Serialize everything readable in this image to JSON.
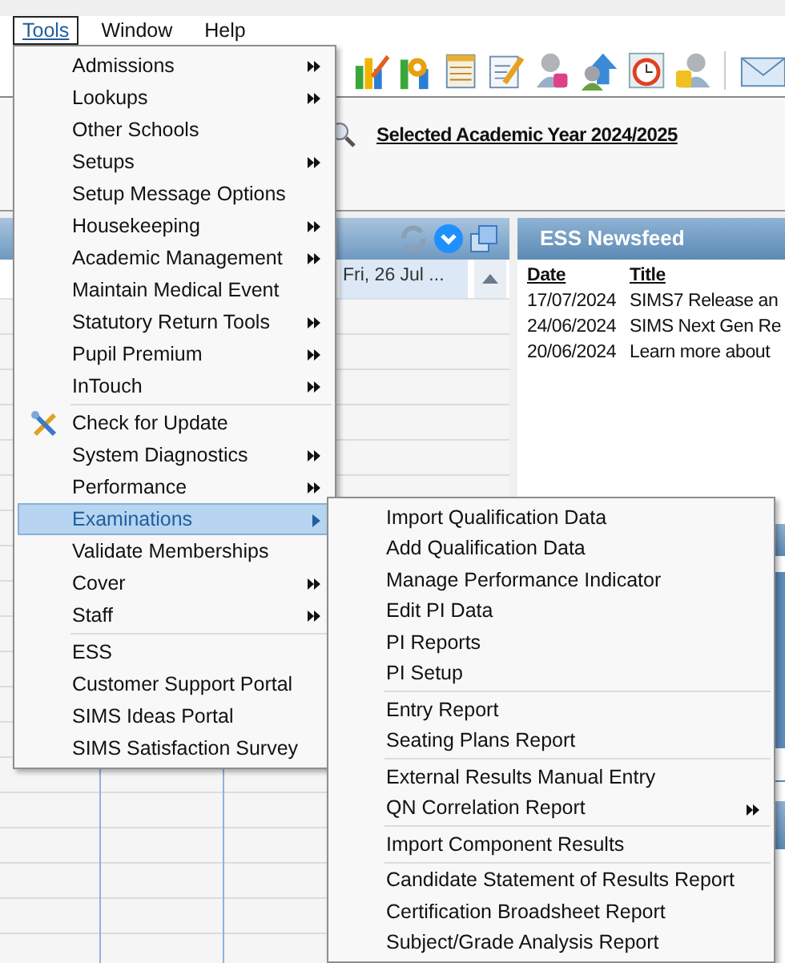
{
  "menubar": [
    {
      "label": "Tools",
      "selected": true
    },
    {
      "label": "Window",
      "selected": false
    },
    {
      "label": "Help",
      "selected": false
    }
  ],
  "academic_year": "Selected Academic Year 2024/2025",
  "calendar": {
    "column_header": "Fri, 26 Jul ..."
  },
  "newsfeed": {
    "title": "ESS Newsfeed",
    "columns": [
      "Date",
      "Title"
    ],
    "rows": [
      {
        "date": "17/07/2024",
        "title": "SIMS7 Release an"
      },
      {
        "date": "24/06/2024",
        "title": "SIMS Next Gen Re"
      },
      {
        "date": "20/06/2024",
        "title": "Learn more about"
      }
    ]
  },
  "tools_menu": {
    "groups": [
      [
        {
          "label": "Admissions",
          "has_submenu": true,
          "selected": false
        },
        {
          "label": "Lookups",
          "has_submenu": true,
          "selected": false
        },
        {
          "label": "Other Schools",
          "has_submenu": false,
          "selected": false
        },
        {
          "label": "Setups",
          "has_submenu": true,
          "selected": false
        },
        {
          "label": "Setup Message Options",
          "has_submenu": false,
          "selected": false
        },
        {
          "label": "Housekeeping",
          "has_submenu": true,
          "selected": false
        },
        {
          "label": "Academic Management",
          "has_submenu": true,
          "selected": false
        },
        {
          "label": "Maintain Medical Event",
          "has_submenu": false,
          "selected": false
        },
        {
          "label": "Statutory Return Tools",
          "has_submenu": true,
          "selected": false
        },
        {
          "label": "Pupil Premium",
          "has_submenu": true,
          "selected": false
        },
        {
          "label": "InTouch",
          "has_submenu": true,
          "selected": false
        }
      ],
      [
        {
          "label": "Check for Update",
          "has_submenu": false,
          "selected": false,
          "has_icon": true
        },
        {
          "label": "System Diagnostics",
          "has_submenu": true,
          "selected": false
        },
        {
          "label": "Performance",
          "has_submenu": true,
          "selected": false
        },
        {
          "label": "Examinations",
          "has_submenu": true,
          "selected": true
        },
        {
          "label": "Validate Memberships",
          "has_submenu": false,
          "selected": false
        },
        {
          "label": "Cover",
          "has_submenu": true,
          "selected": false
        },
        {
          "label": "Staff",
          "has_submenu": true,
          "selected": false
        }
      ],
      [
        {
          "label": "ESS",
          "has_submenu": false,
          "selected": false
        },
        {
          "label": "Customer Support Portal",
          "has_submenu": false,
          "selected": false
        },
        {
          "label": "SIMS Ideas Portal",
          "has_submenu": false,
          "selected": false
        },
        {
          "label": "SIMS Satisfaction Survey",
          "has_submenu": false,
          "selected": false
        }
      ]
    ]
  },
  "examinations_submenu": {
    "groups": [
      [
        {
          "label": "Import Qualification Data",
          "has_submenu": false
        },
        {
          "label": "Add Qualification Data",
          "has_submenu": false
        },
        {
          "label": "Manage Performance Indicator",
          "has_submenu": false
        },
        {
          "label": "Edit PI Data",
          "has_submenu": false
        },
        {
          "label": "PI Reports",
          "has_submenu": false
        },
        {
          "label": "PI Setup",
          "has_submenu": false
        }
      ],
      [
        {
          "label": "Entry Report",
          "has_submenu": false
        },
        {
          "label": "Seating Plans Report",
          "has_submenu": false
        }
      ],
      [
        {
          "label": "External Results Manual Entry",
          "has_submenu": false
        },
        {
          "label": "QN Correlation Report",
          "has_submenu": true
        }
      ],
      [
        {
          "label": "Import Component Results",
          "has_submenu": false
        }
      ],
      [
        {
          "label": "Candidate Statement of Results Report",
          "has_submenu": false
        },
        {
          "label": "Certification Broadsheet Report",
          "has_submenu": false
        },
        {
          "label": "Subject/Grade Analysis Report",
          "has_submenu": false
        }
      ]
    ]
  }
}
